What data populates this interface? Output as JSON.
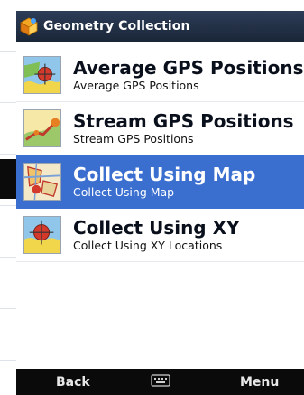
{
  "window": {
    "title": "Geometry Collection"
  },
  "items": [
    {
      "main": "Average GPS Positions",
      "sub": "Average GPS Positions",
      "icon": "gps-average-icon",
      "selected": false
    },
    {
      "main": "Stream GPS Positions",
      "sub": "Stream GPS Positions",
      "icon": "gps-stream-icon",
      "selected": false
    },
    {
      "main": "Collect Using Map",
      "sub": "Collect Using Map",
      "icon": "map-collect-icon",
      "selected": true
    },
    {
      "main": "Collect Using XY",
      "sub": "Collect Using XY Locations",
      "icon": "xy-collect-icon",
      "selected": false
    }
  ],
  "softkeys": {
    "left": "Back",
    "right": "Menu",
    "center_icon": "keyboard-icon"
  },
  "colors": {
    "titlebar": "#1f2c42",
    "selection": "#3a6fd0",
    "softbar": "#0a0a0a"
  }
}
